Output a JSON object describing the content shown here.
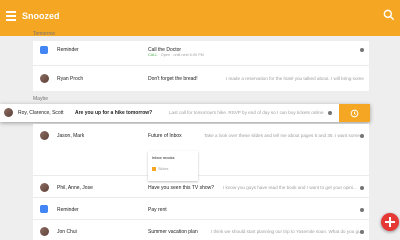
{
  "app": {
    "title": "Snoozed",
    "accent": "#f5a623"
  },
  "sections": {
    "tomorrow": "Tomorrow",
    "maybe": "Maybe"
  },
  "tomorrow_rows": [
    {
      "sender": "Reminder",
      "subject": "Call the Doctor",
      "sub2_label": "CALL",
      "sub2_text": "· Open · until next 6:00 PM",
      "snippet": ""
    },
    {
      "sender": "Ryan Proch",
      "subject": "Don't forget the bread!",
      "snippet": "I made a reservation for the hotel you talked about. I will bring some wine and"
    }
  ],
  "floating_row": {
    "sender": "Roy, Clarence, Scott",
    "subject": "Are you up for a hike tomorrow?",
    "snippet": "Last call for tomorrow's hike. RSVP by end of day so I can buy tickets online..."
  },
  "maybe_rows": [
    {
      "sender": "Jason, Mark",
      "subject": "Future of Inbox",
      "snippet": "Take a look over these slides and tell me about pages 5 and 35. I want some images right below"
    },
    {
      "sender": "Phil, Anne, Jose",
      "subject": "Have you seen this TV show?",
      "snippet": "I know you guys have read the book and I want to get your opini..."
    },
    {
      "sender": "Reminder",
      "subject": "Pay rent",
      "snippet": ""
    },
    {
      "sender": "Jon Chui",
      "subject": "Summer vacation plan",
      "snippet": "I think we should start planning our trip to Yosemite soon. What do you guys"
    }
  ],
  "attachment": {
    "name": "Inbox mocks",
    "type": "Slides"
  }
}
